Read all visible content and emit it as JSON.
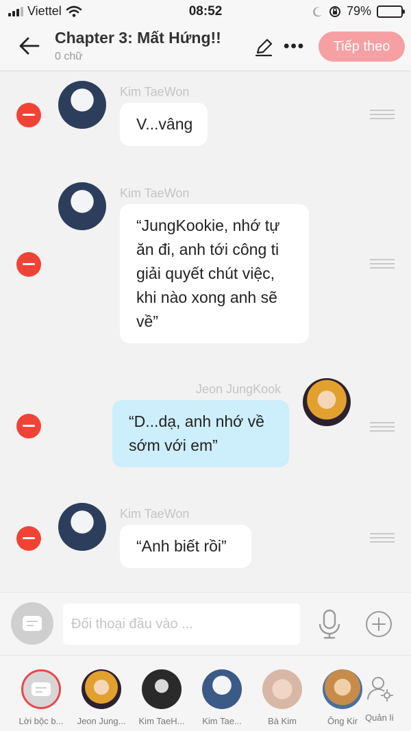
{
  "status_bar": {
    "carrier": "Viettel",
    "time": "08:52",
    "battery": "79%",
    "battery_level": 0.79
  },
  "header": {
    "title": "Chapter 3: Mất Hứng!!",
    "subtitle": "0 chữ",
    "next_label": "Tiếp theo"
  },
  "messages": [
    {
      "speaker": "Kim TaeWon",
      "side": "left",
      "text": "V...vâng",
      "lines": [
        "V...vâng"
      ]
    },
    {
      "speaker": "Kim TaeWon",
      "side": "left",
      "text": "“JungKookie, nhớ tự ăn đi, anh tới công ti giải quyết chút việc, khi nào xong anh sẽ về”",
      "lines": [
        "“JungKookie, nhớ tự",
        "ăn đi, anh tới công ti",
        "giải quyết chút việc,",
        "khi nào xong anh sẽ",
        "về”"
      ]
    },
    {
      "speaker": "Jeon JungKook",
      "side": "right",
      "text": "“D...dạ, anh nhớ về sớm với em”",
      "lines": [
        "“D...dạ, anh nhớ về",
        "sớm với em”"
      ]
    },
    {
      "speaker": "Kim TaeWon",
      "side": "left",
      "text": "“Anh biết rồi”",
      "lines": [
        "“Anh biết rồi”"
      ]
    }
  ],
  "composer": {
    "placeholder": "Đối thoại đầu vào ..."
  },
  "characters": [
    {
      "label": "Lời bộc b...",
      "type": "narrator"
    },
    {
      "label": "Jeon Jung...",
      "type": "avatar",
      "color": "#e2a02e"
    },
    {
      "label": "Kim TaeH...",
      "type": "avatar",
      "color": "#2a2a2a"
    },
    {
      "label": "Kim Tae...",
      "type": "avatar",
      "color": "#3b5a86"
    },
    {
      "label": "Bà Kim",
      "type": "avatar",
      "color": "#d9b7a6"
    },
    {
      "label": "Ông Kir",
      "type": "avatar",
      "color": "#c78b4a"
    }
  ],
  "manage_label": "Quản lí",
  "colors": {
    "accent": "#f7a0a4",
    "delete": "#f04336",
    "bubble_blue": "#cdeefb"
  }
}
